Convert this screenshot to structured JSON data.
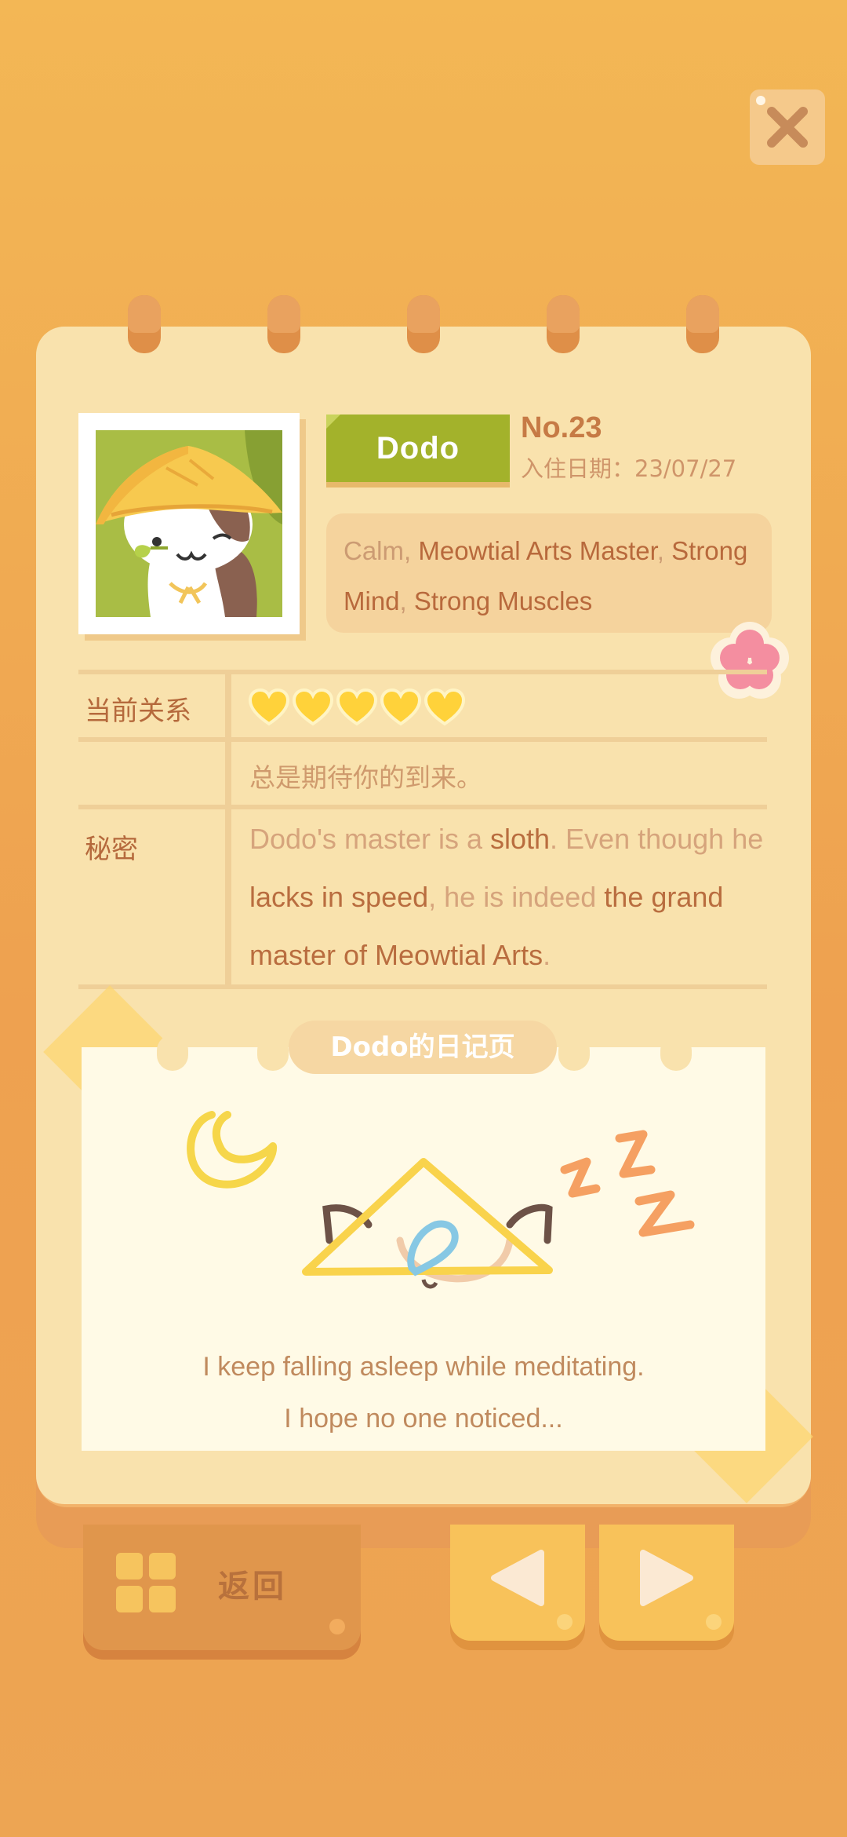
{
  "profile": {
    "name": "Dodo",
    "number": "No.23",
    "join_date": "入住日期：23/07/27",
    "traits": [
      {
        "text": "Calm",
        "highlight": false
      },
      {
        "text": ", ",
        "highlight": false
      },
      {
        "text": "Meowtial Arts Master",
        "highlight": true
      },
      {
        "text": ", ",
        "highlight": false
      },
      {
        "text": "Strong Mind",
        "highlight": true
      },
      {
        "text": ", ",
        "highlight": false
      },
      {
        "text": "Strong Muscles",
        "highlight": true
      }
    ]
  },
  "relation": {
    "label": "当前关系",
    "hearts": 5,
    "heart_color": "#ffd23a",
    "status_text": "总是期待你的到来。"
  },
  "secret": {
    "label": "秘密",
    "segments": [
      {
        "text": "Dodo's master is a ",
        "highlight": false
      },
      {
        "text": "sloth",
        "highlight": true
      },
      {
        "text": ". Even though he ",
        "highlight": false
      },
      {
        "text": "lacks in speed",
        "highlight": true
      },
      {
        "text": ", he is indeed ",
        "highlight": false
      },
      {
        "text": "the grand master of Meowtial Arts",
        "highlight": true
      },
      {
        "text": ".",
        "highlight": false
      }
    ]
  },
  "diary": {
    "title": "Dodo的日记页",
    "line1": "I keep falling asleep while meditating.",
    "line2": "I hope no one noticed..."
  },
  "buttons": {
    "back_label": "返回",
    "close_icon": "close-icon",
    "prev_icon": "triangle-left-icon",
    "next_icon": "triangle-right-icon"
  },
  "colors": {
    "background": "#f0ad52",
    "page": "#f9e2ad",
    "name_plate": "#a3b22b",
    "accent_text": "#b8693c"
  }
}
